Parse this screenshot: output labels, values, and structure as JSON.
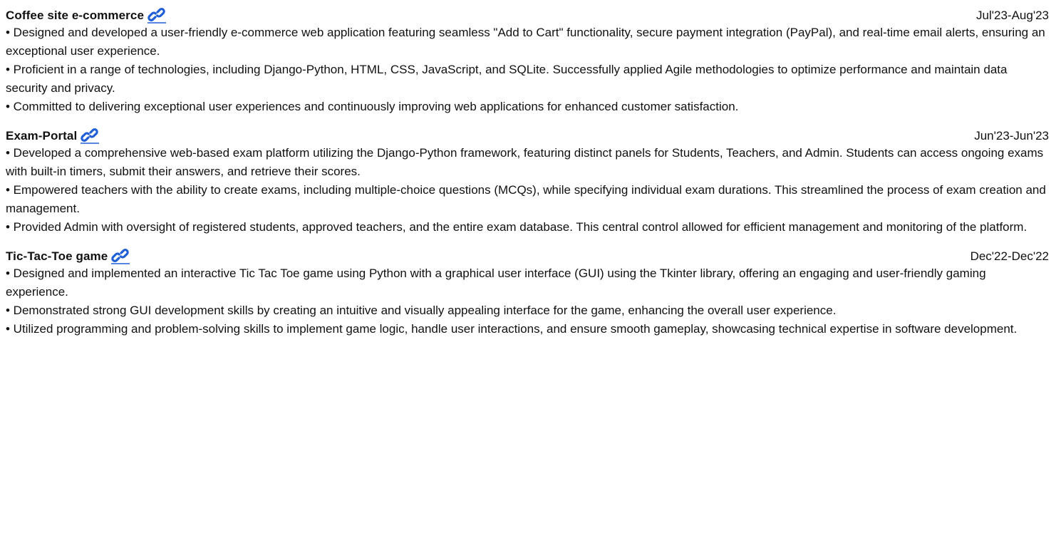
{
  "projects": [
    {
      "title": "Coffee site e-commerce",
      "dates": "Jul'23-Aug'23",
      "bullets": [
        "• Designed and developed a user-friendly e-commerce web application featuring seamless \"Add to Cart\" functionality, secure payment integration (PayPal), and real-time email alerts, ensuring an exceptional user experience.",
        "• Proficient in a range of technologies, including Django-Python, HTML, CSS, JavaScript, and SQLite. Successfully applied Agile methodologies to optimize performance and maintain data security and privacy.",
        "• Committed to delivering exceptional user experiences and continuously improving web applications for enhanced customer satisfaction."
      ]
    },
    {
      "title": "Exam-Portal",
      "dates": "Jun'23-Jun'23",
      "bullets": [
        "• Developed a comprehensive web-based exam platform utilizing the Django-Python framework, featuring distinct panels for Students, Teachers, and Admin. Students can access ongoing exams with built-in timers, submit their answers, and retrieve their scores.",
        "• Empowered teachers with the ability to create exams, including multiple-choice questions (MCQs), while specifying individual exam durations. This streamlined the process of exam creation and management.",
        "• Provided Admin with oversight of registered students, approved teachers, and the entire exam database. This central control allowed for efficient management and monitoring of the platform."
      ]
    },
    {
      "title": "Tic-Tac-Toe game",
      "dates": "Dec'22-Dec'22",
      "bullets": [
        "• Designed and implemented an interactive Tic Tac Toe game using Python with a graphical user interface (GUI) using the Tkinter library, offering an engaging and user-friendly gaming experience.",
        "• Demonstrated strong GUI development skills by creating an intuitive and visually appealing interface for the game, enhancing the overall user experience.",
        "• Utilized programming and problem-solving skills to implement game logic, handle user interactions, and ensure smooth gameplay, showcasing technical expertise in software development."
      ]
    }
  ],
  "icons": {
    "link": "link-icon"
  },
  "colors": {
    "link_icon": "#1f5fd6",
    "text": "#111111"
  }
}
